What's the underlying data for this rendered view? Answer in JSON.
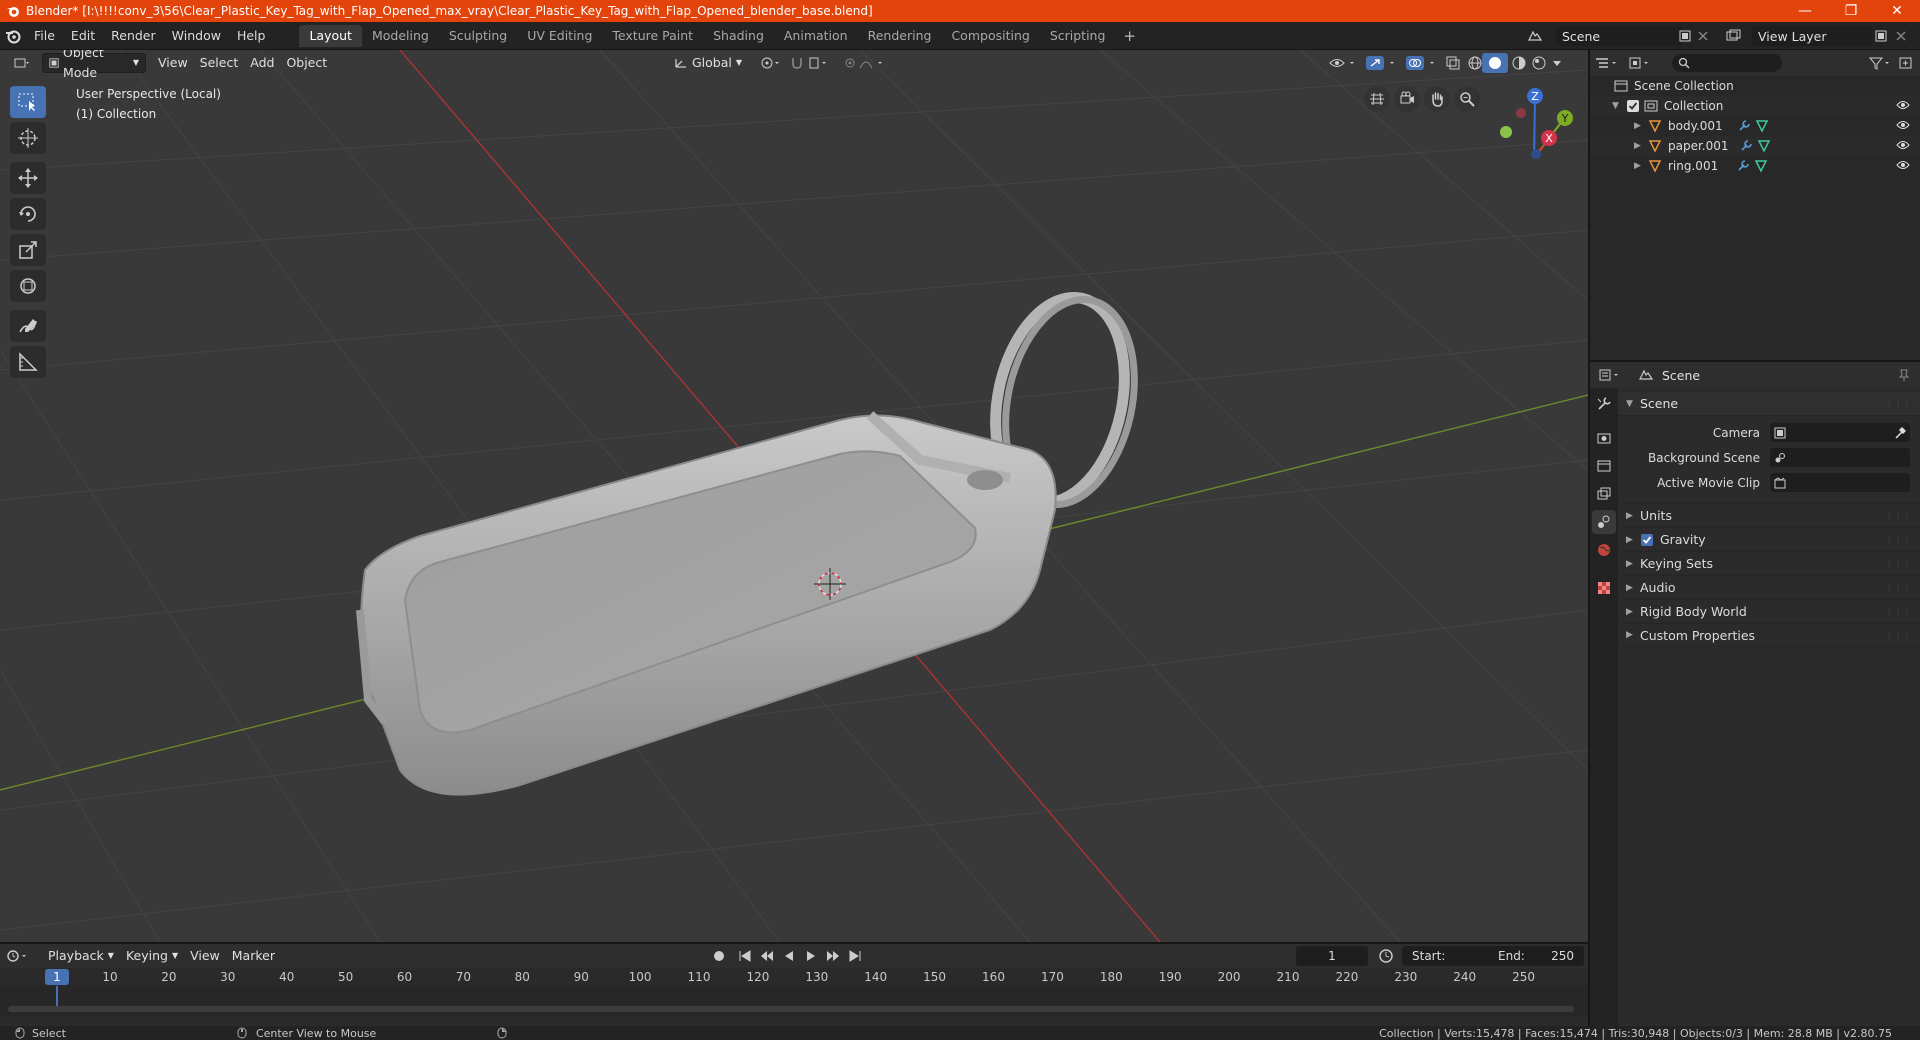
{
  "window": {
    "title": "Blender* [I:\\!!!!conv_3\\56\\Clear_Plastic_Key_Tag_with_Flap_Opened_max_vray\\Clear_Plastic_Key_Tag_with_Flap_Opened_blender_base.blend]",
    "minimize": "—",
    "maximize": "❐",
    "close": "✕"
  },
  "menu": [
    "File",
    "Edit",
    "Render",
    "Window",
    "Help"
  ],
  "workspaces": [
    "Layout",
    "Modeling",
    "Sculpting",
    "UV Editing",
    "Texture Paint",
    "Shading",
    "Animation",
    "Rendering",
    "Compositing",
    "Scripting"
  ],
  "workspace_add": "+",
  "scene_selector": "Scene",
  "view_layer_selector": "View Layer",
  "viewport": {
    "mode": "Object Mode",
    "menus": [
      "View",
      "Select",
      "Add",
      "Object"
    ],
    "orientation": "Global",
    "info_line1": "User Perspective (Local)",
    "info_line2": "(1) Collection",
    "gizmo": {
      "z": "Z",
      "y": "Y",
      "x": "X"
    }
  },
  "outliner": {
    "root": "Scene Collection",
    "collection": "Collection",
    "objects": [
      "body.001",
      "paper.001",
      "ring.001"
    ]
  },
  "properties": {
    "header": "Scene",
    "panel": "Scene",
    "camera_label": "Camera",
    "background_scene_label": "Background Scene",
    "active_movie_clip_label": "Active Movie Clip",
    "subpanels": [
      "Units",
      "Gravity",
      "Keying Sets",
      "Audio",
      "Rigid Body World",
      "Custom Properties"
    ],
    "gravity_checked": true
  },
  "timeline": {
    "menus": [
      "Playback",
      "Keying",
      "View",
      "Marker"
    ],
    "current_frame": "1",
    "start_label": "Start:",
    "start_value": "1",
    "end_label": "End:",
    "end_value": "250",
    "ruler": [
      "1",
      "10",
      "20",
      "30",
      "40",
      "50",
      "60",
      "70",
      "80",
      "90",
      "100",
      "110",
      "120",
      "130",
      "140",
      "150",
      "160",
      "170",
      "180",
      "190",
      "200",
      "210",
      "220",
      "230",
      "240",
      "250"
    ]
  },
  "status": {
    "left1": "Select",
    "left2": "Center View to Mouse",
    "right": "Collection | Verts:15,478 | Faces:15,474 | Tris:30,948 | Objects:0/3 | Mem: 28.8 MB | v2.80.75"
  }
}
